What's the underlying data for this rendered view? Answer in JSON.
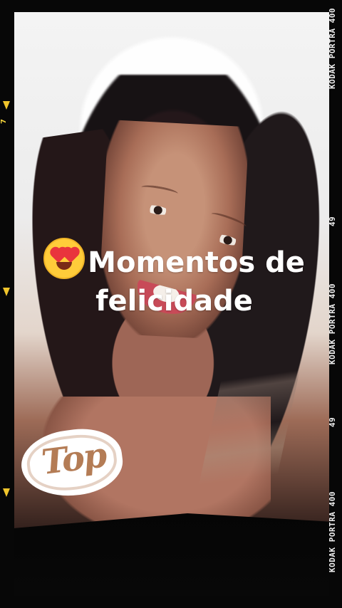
{
  "caption": {
    "emoji_name": "heart-eyes-emoji",
    "line1": "Momentos de",
    "line2": "felicidade"
  },
  "sticker": {
    "text": "Top"
  },
  "film_edge": {
    "top": "KODAK PORTRA 400",
    "middle_number": "49",
    "middle": "KODAK PORTRA 400",
    "lower_number": "49",
    "lower": "KODAK PORTRA 400",
    "left_number": "7"
  },
  "colors": {
    "caption_text": "#ffffff",
    "film_background": "#070707",
    "sticker_accent": "#b47c55",
    "film_marks": "#f0c52c"
  }
}
